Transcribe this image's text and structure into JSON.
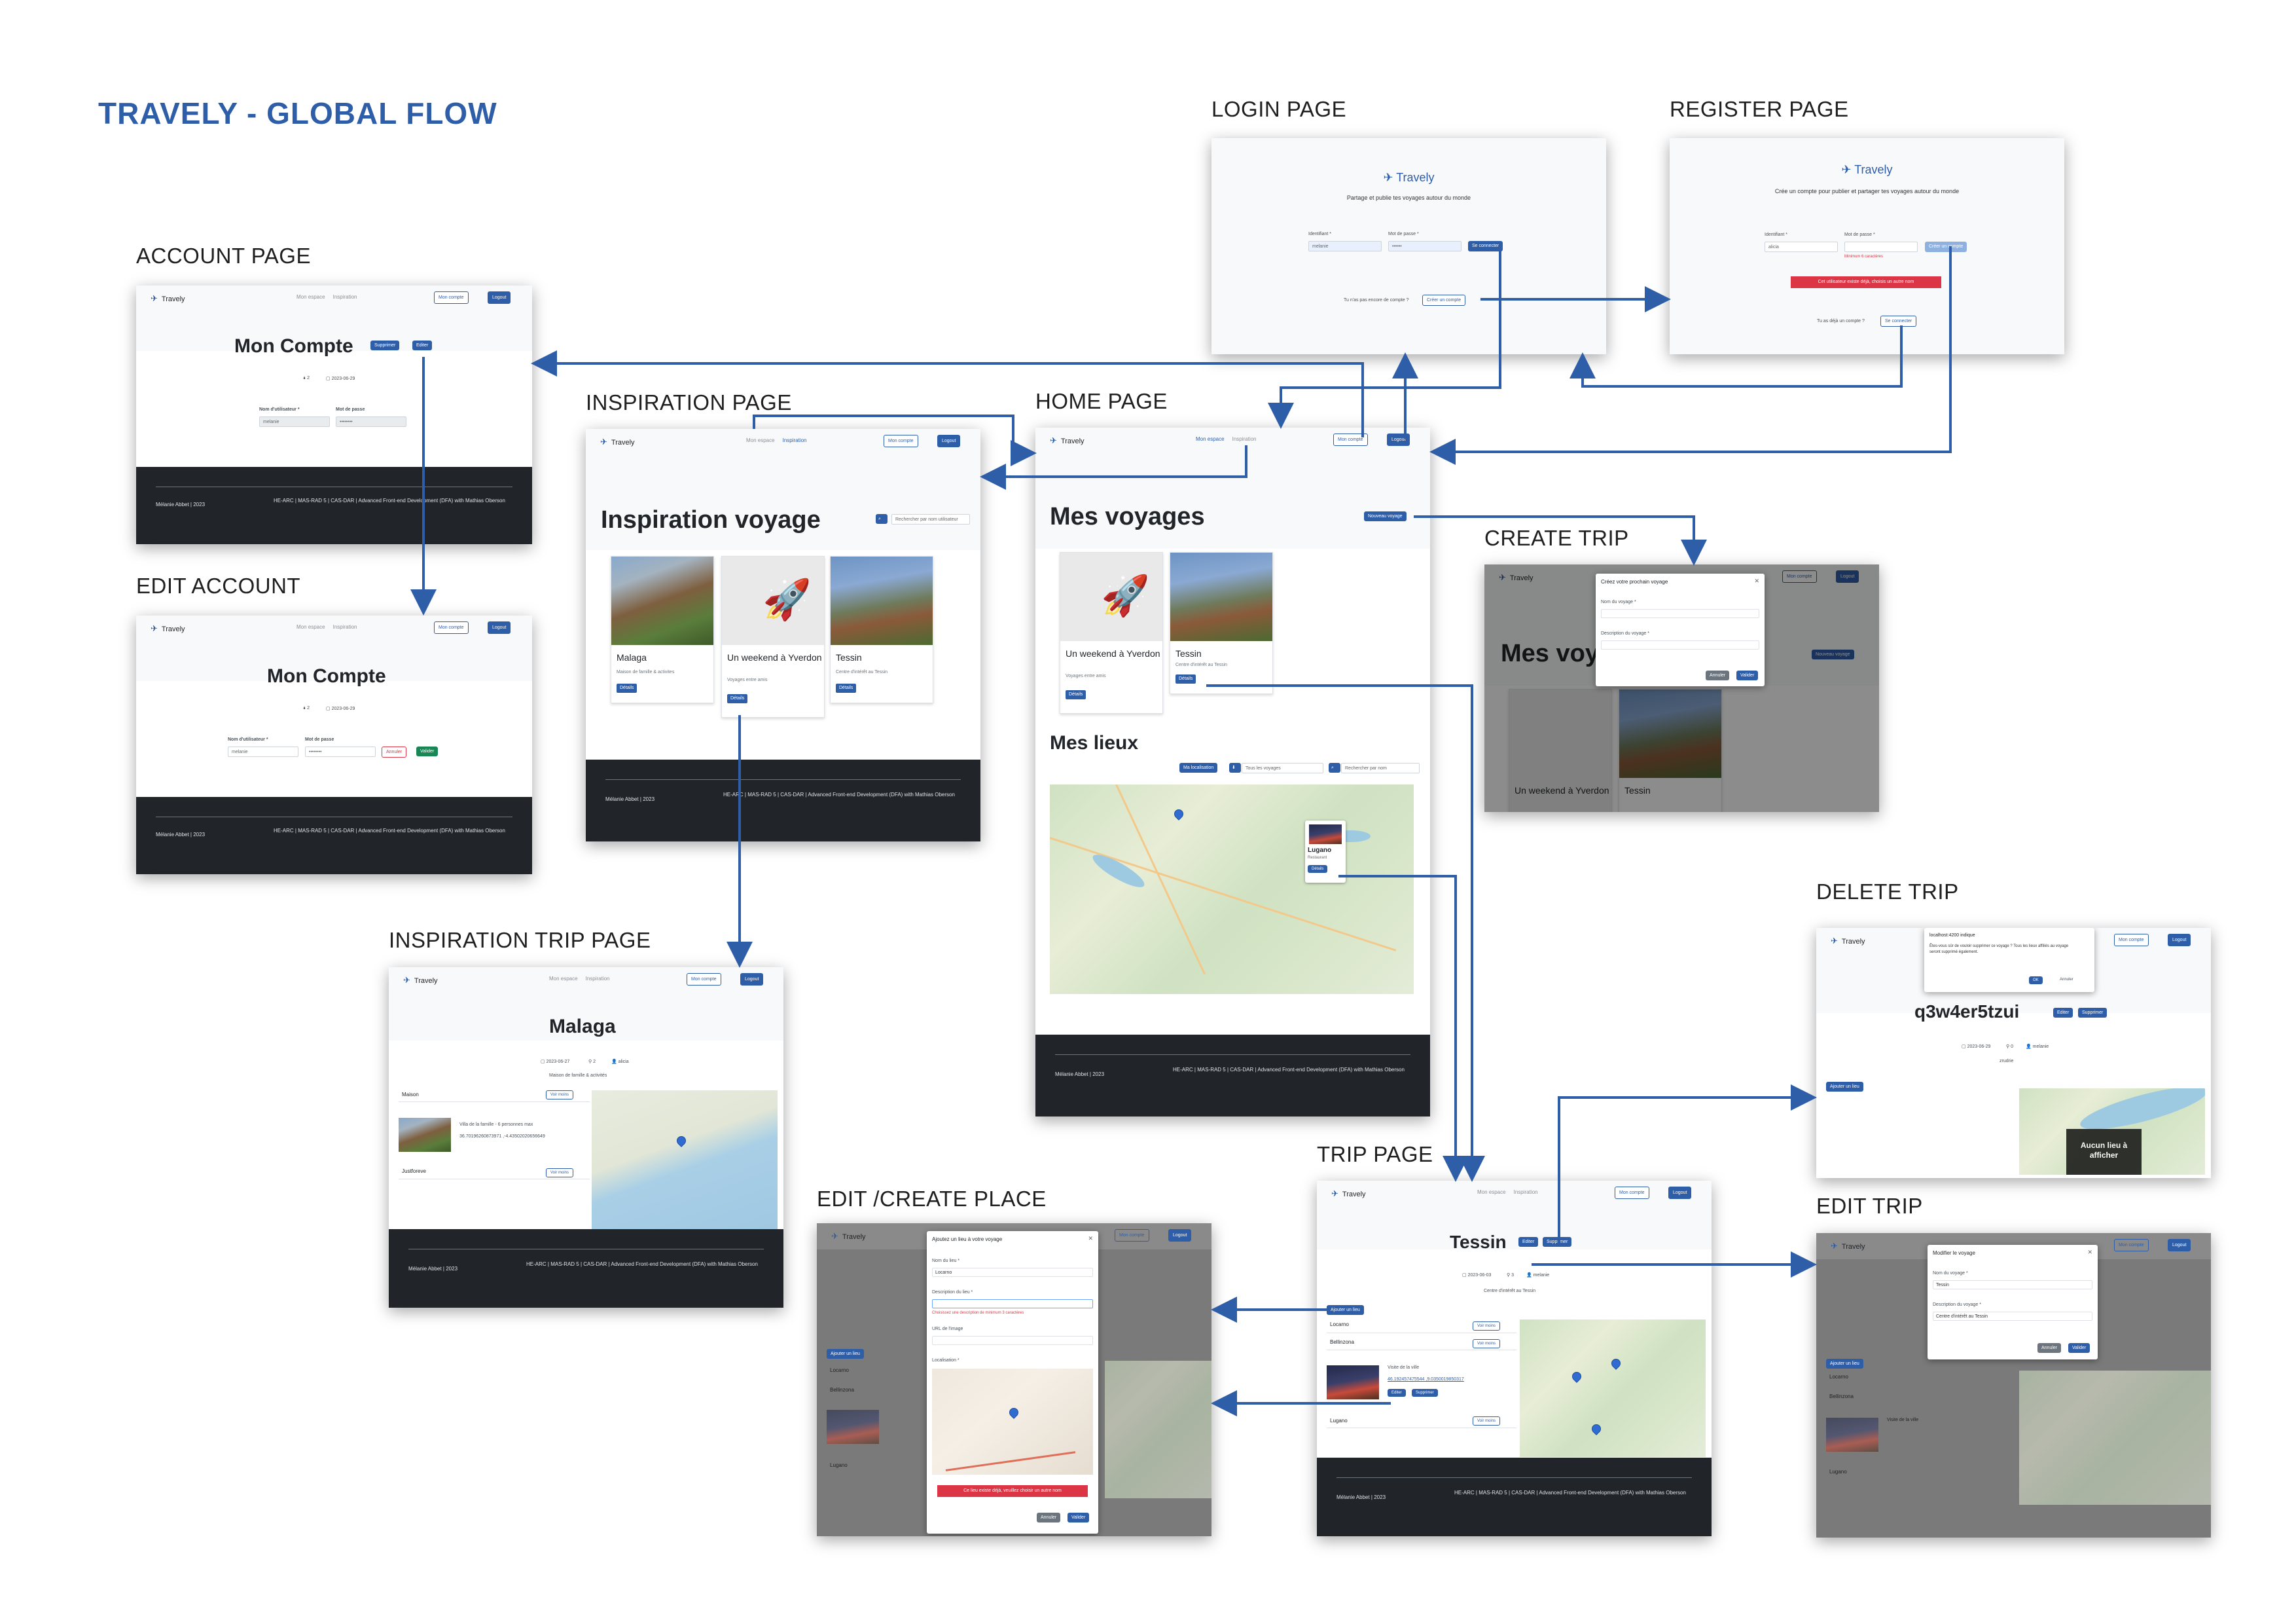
{
  "flow_title": "TRAVELY - GLOBAL FLOW",
  "labels": {
    "account": "ACCOUNT PAGE",
    "edit_account": "EDIT ACCOUNT",
    "inspiration": "INSPIRATION PAGE",
    "home": "HOME PAGE",
    "login": "LOGIN PAGE",
    "register": "REGISTER PAGE",
    "create_trip": "CREATE TRIP",
    "inspiration_trip": "INSPIRATION TRIP PAGE",
    "delete_trip": "DELETE TRIP",
    "trip": "TRIP PAGE",
    "edit_create_place": "EDIT /CREATE PLACE",
    "edit_trip": "EDIT TRIP"
  },
  "app": {
    "brand": "Travely",
    "nav_space": "Mon espace",
    "nav_inspiration": "Inspiration",
    "my_account_btn": "Mon compte",
    "logout_btn": "Logout",
    "footer_author": "Mélanie Abbet | 2023",
    "footer_course": "HE-ARC | MAS-RAD 5 | CAS-DAR | Advanced Front-end Development (DFA) with Mathias Oberson"
  },
  "login": {
    "tagline": "Partage et publie tes voyages autour du monde",
    "id_label": "Identifiant *",
    "pw_label": "Mot de passe *",
    "id_value": "melanie",
    "pw_value": "••••••",
    "submit": "Se connecter",
    "no_account": "Tu n'as pas encore de compte ?",
    "create_account": "Créer un compte"
  },
  "register": {
    "tagline": "Crée un compte pour publier et partager tes voyages autour du monde",
    "id_label": "Identifiant *",
    "pw_label": "Mot de passe *",
    "id_value": "alicia",
    "submit": "Créer un compte",
    "hint": "Minimum 6 caractères",
    "error": "Cet utilisateur existe déjà, choisis un autre nom",
    "has_account": "Tu as déjà un compte ?",
    "login_link": "Se connecter"
  },
  "account": {
    "title": "Mon Compte",
    "delete_btn": "Supprimer",
    "edit_btn": "Editer",
    "trips_count": "2",
    "date": "2023-06-29",
    "username_label": "Nom d'utilisateur *",
    "password_label": "Mot de passe",
    "username_value": "melanie",
    "password_value": "••••••••",
    "cancel_btn": "Annuler",
    "validate_btn": "Valider"
  },
  "inspiration": {
    "title": "Inspiration voyage",
    "search_placeholder": "Rechercher par nom utilisateur",
    "cards": [
      {
        "title": "Malaga",
        "subtitle": "Maison de famille & activites",
        "badge": "2",
        "button": "Détails"
      },
      {
        "title": "Un weekend à Yverdon",
        "subtitle": "Voyages entre amis",
        "badge": "2",
        "button": "Détails"
      },
      {
        "title": "Tessin",
        "subtitle": "Centre d'intérêt au Tessin",
        "badge": "3",
        "button": "Détails"
      }
    ]
  },
  "home": {
    "title": "Mes voyages",
    "new_trip_btn": "Nouveau voyage",
    "cards": [
      {
        "title": "Un weekend à Yverdon",
        "subtitle": "Voyages entre amis",
        "badge": "2",
        "button": "Détails"
      },
      {
        "title": "Tessin",
        "subtitle": "Centre d'intérêt au Tessin",
        "badge": "3",
        "button": "Détails"
      }
    ],
    "places_title": "Mes lieux",
    "my_location_btn": "Ma localisation",
    "all_trips_select": "Tous les voyages",
    "search_placeholder": "Rechercher par nom",
    "popup_title": "Lugano",
    "popup_sub": "Restaurant",
    "popup_btn": "Détails"
  },
  "create_trip": {
    "modal_title": "Créez votre prochain voyage",
    "name_label": "Nom du voyage *",
    "desc_label": "Description du voyage *",
    "cancel": "Annuler",
    "validate": "Valider",
    "bg_title": "Mes voy",
    "bg_new_btn": "Nouveau voyage",
    "bg_card1": "Un weekend à Yverdon",
    "bg_card2": "Tessin"
  },
  "inspiration_trip": {
    "title": "Malaga",
    "date": "2023-06-27",
    "places_count": "2",
    "user": "alicia",
    "description": "Maison de famille & activités",
    "place1": "Maison",
    "place1_btn": "Voir moins",
    "place1_desc": "Villa de la famille - 6 personnes max",
    "place1_coords": "36.70196260873971 ,-4.43502020656649",
    "place2": "Justforeve",
    "place2_btn": "Voir moins"
  },
  "delete_trip": {
    "dialog_host": "localhost:4200 indique",
    "dialog_text": "Êtes-vous sûr de vouloir supprimer ce voyage ? Tous les lieux affiliés au voyage seront supprimé également.",
    "ok": "OK",
    "cancel": "Annuler",
    "title": "q3w4er5tzui",
    "edit": "Editer",
    "delete": "Supprimer",
    "date": "2023-06-29",
    "count": "0",
    "user": "melanie",
    "desc": "zrudrie",
    "add_place": "Ajouter un lieu",
    "no_place": "Aucun lieu à afficher"
  },
  "trip": {
    "title": "Tessin",
    "edit": "Editer",
    "delete": "Supprimer",
    "date": "2023-06-03",
    "count": "3",
    "user": "melanie",
    "description": "Centre d'intérêt au Tessin",
    "add_place": "Ajouter un lieu",
    "places": [
      "Locarno",
      "Bellinzona",
      "Lugano"
    ],
    "see_more": "Voir moins",
    "place_desc": "Visite de la ville",
    "place_coords": "46.192457475544 ,9.0350019850317",
    "edit_btn": "Editer",
    "delete_btn": "Supprimer"
  },
  "edit_place": {
    "modal_title": "Ajoutez un lieu à votre voyage",
    "name_label": "Nom du lieu *",
    "name_value": "Locarno",
    "desc_label": "Description du lieu *",
    "desc_error": "Choisissez une description de minimum 3 caractères",
    "url_label": "URL de l'image",
    "loc_label": "Localisation *",
    "exists_error": "Ce lieu existe déjà, veuillez choisir un autre nom",
    "cancel": "Annuler",
    "validate": "Valider",
    "bg_add": "Ajouter un lieu",
    "bg_locarno": "Locarno",
    "bg_bellinzona": "Bellinzona",
    "bg_lugano": "Lugano"
  },
  "edit_trip": {
    "modal_title": "Modifier le voyage",
    "name_label": "Nom du voyage *",
    "name_value": "Tessin",
    "desc_label": "Description du voyage *",
    "desc_value": "Centre d'intérêt au Tessin",
    "cancel": "Annuler",
    "validate": "Valider",
    "bg_add": "Ajouter un lieu",
    "bg_locarno": "Locarno",
    "bg_bellinzona": "Bellinzona",
    "bg_lugano": "Lugano",
    "bg_desc": "Visite de la ville"
  },
  "colors": {
    "accent": "#2f5ea8",
    "footer": "#212529",
    "danger": "#dc3545",
    "success": "#198754"
  }
}
